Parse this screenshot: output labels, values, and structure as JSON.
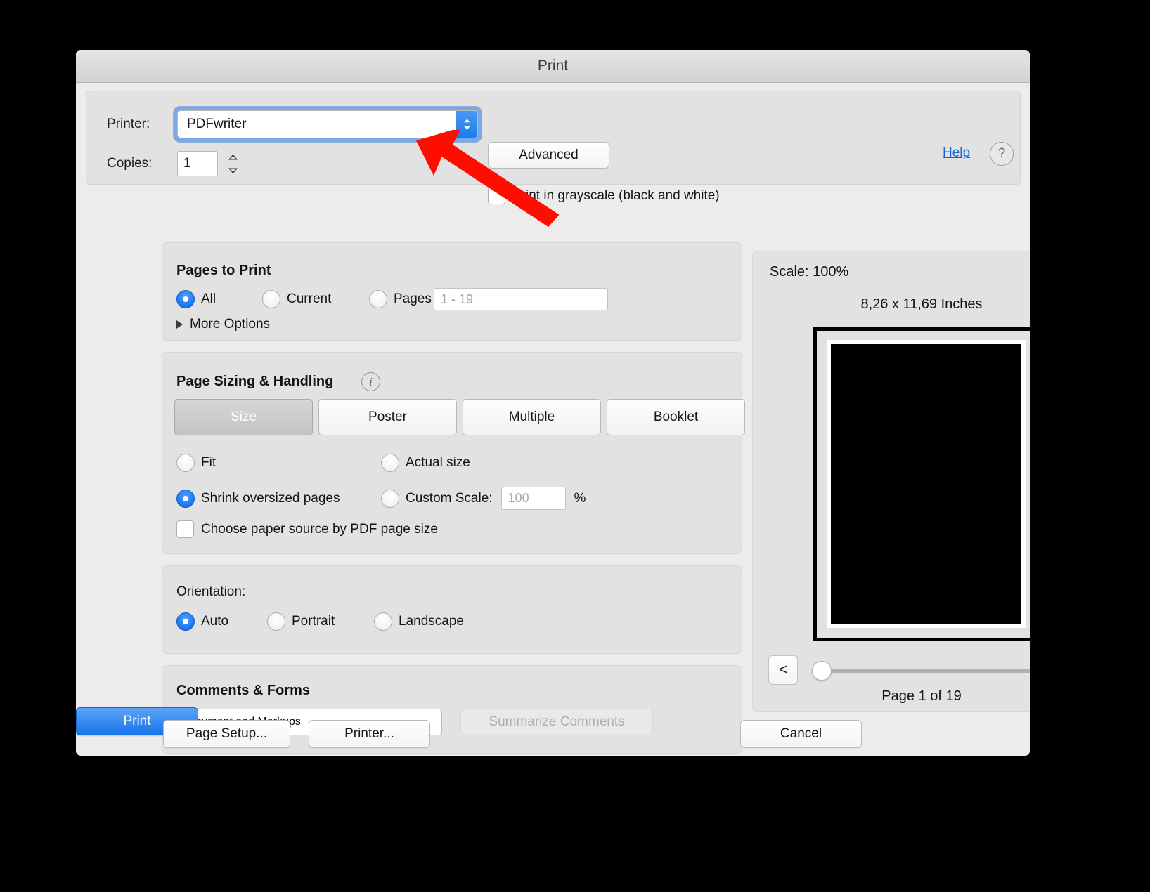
{
  "window": {
    "title": "Print"
  },
  "printer_panel": {
    "printer_label": "Printer:",
    "printer_value": "PDFwriter",
    "advanced_label": "Advanced",
    "help_link": "Help",
    "help_icon_glyph": "?",
    "copies_label": "Copies:",
    "copies_value": "1",
    "grayscale_label": "Print in grayscale (black and white)",
    "grayscale_checked": false
  },
  "pages_to_print": {
    "title": "Pages to Print",
    "options": [
      {
        "label": "All",
        "selected": true
      },
      {
        "label": "Current",
        "selected": false
      },
      {
        "label": "Pages",
        "selected": false
      }
    ],
    "pages_input_placeholder": "1 - 19",
    "pages_input_value": "",
    "more_options_label": "More Options"
  },
  "page_sizing": {
    "title": "Page Sizing & Handling",
    "info_glyph": "i",
    "tabs": [
      {
        "label": "Size",
        "active": true
      },
      {
        "label": "Poster",
        "active": false
      },
      {
        "label": "Multiple",
        "active": false
      },
      {
        "label": "Booklet",
        "active": false
      }
    ],
    "options": [
      {
        "label": "Fit",
        "selected": false
      },
      {
        "label": "Actual size",
        "selected": false
      },
      {
        "label": "Shrink oversized pages",
        "selected": true
      },
      {
        "label": "Custom Scale:",
        "selected": false
      }
    ],
    "custom_scale_placeholder": "100",
    "custom_scale_value": "",
    "percent_symbol": "%",
    "paper_source_label": "Choose paper source by PDF page size",
    "paper_source_checked": false
  },
  "orientation": {
    "title": "Orientation:",
    "options": [
      {
        "label": "Auto",
        "selected": true
      },
      {
        "label": "Portrait",
        "selected": false
      },
      {
        "label": "Landscape",
        "selected": false
      }
    ]
  },
  "comments_forms": {
    "title": "Comments & Forms",
    "selected_value": "Document and Markups",
    "summarize_label": "Summarize Comments",
    "summarize_enabled": false
  },
  "preview": {
    "scale_text": "Scale: 100%",
    "dimensions_text": "8,26 x 11,69 Inches",
    "prev_label": "<",
    "next_label": ">",
    "page_counter": "Page 1 of 19",
    "slider_position_percent": 0
  },
  "bottom_bar": {
    "page_setup_label": "Page Setup...",
    "printer_label": "Printer...",
    "cancel_label": "Cancel",
    "print_label": "Print"
  },
  "annotation": {
    "arrow_color": "#FF0D00"
  },
  "colors": {
    "accent_blue": "#1874e8",
    "link_blue": "#1267d2",
    "dialog_bg": "#ececec",
    "section_bg": "#e2e2e2",
    "backdrop": "#000000"
  }
}
